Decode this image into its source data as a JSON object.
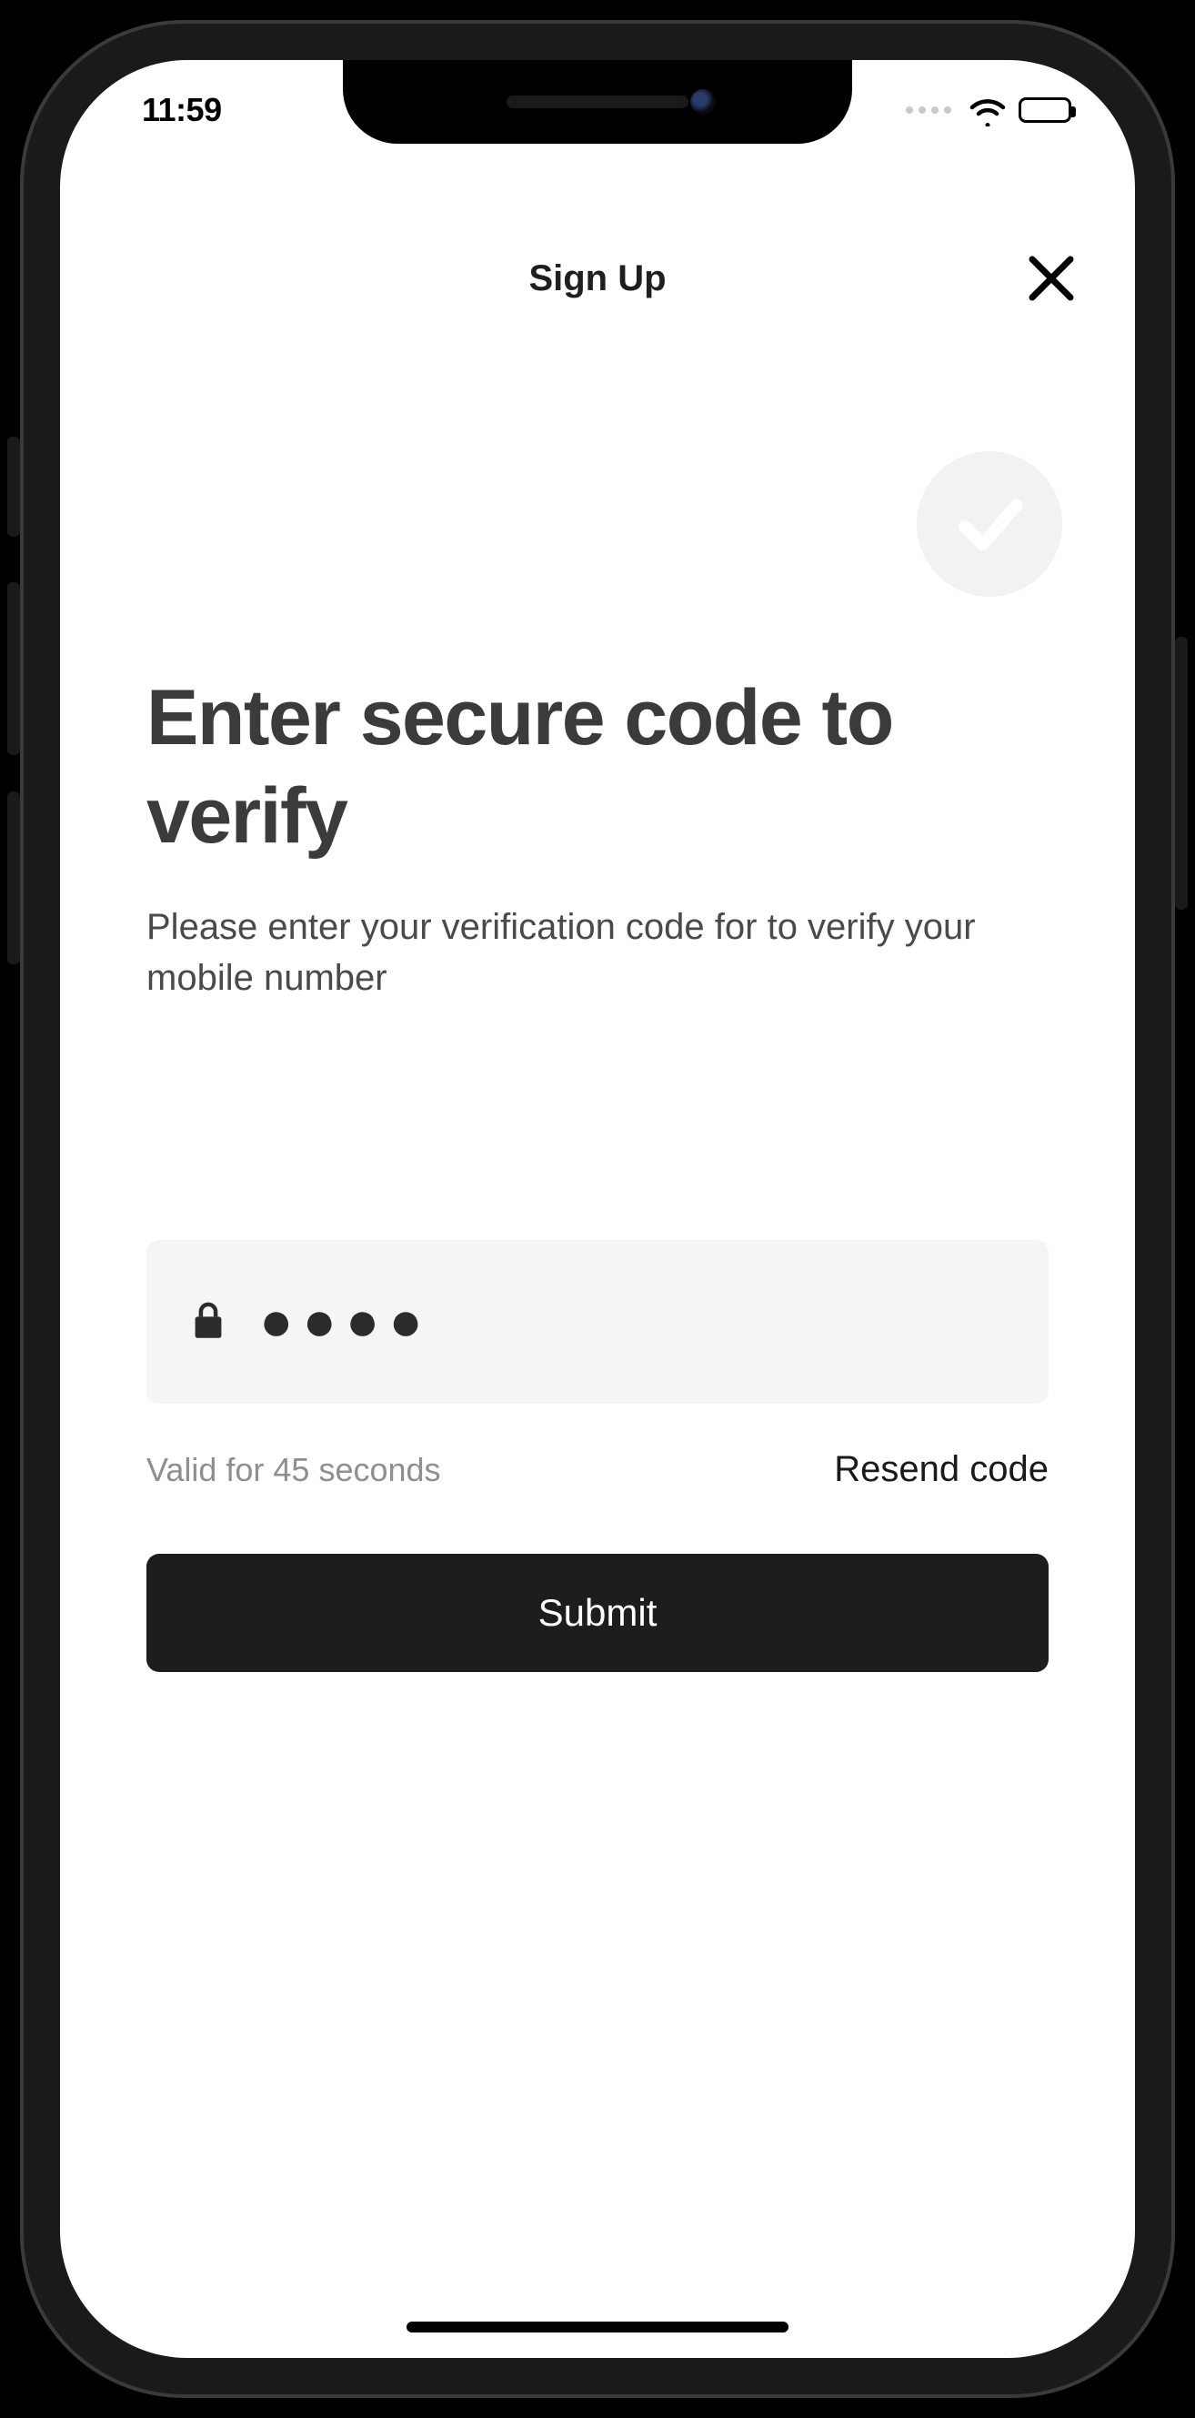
{
  "status": {
    "time": "11:59"
  },
  "nav": {
    "title": "Sign Up"
  },
  "main": {
    "title": "Enter secure code to verify",
    "subtitle": "Please enter your verification code for to verify your mobile number",
    "code_value": "●●●●",
    "valid_text": "Valid for 45 seconds",
    "resend_label": "Resend code",
    "submit_label": "Submit"
  }
}
